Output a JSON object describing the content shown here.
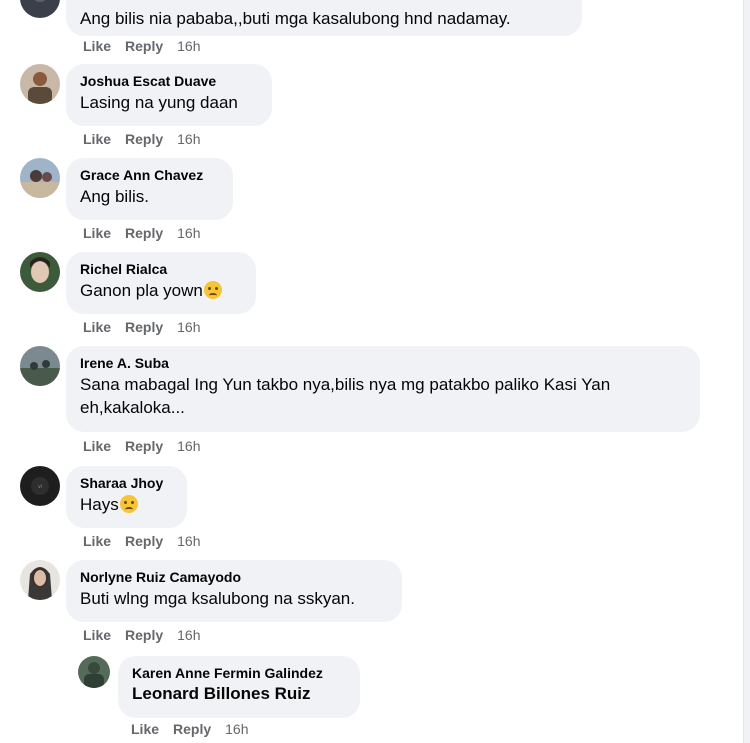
{
  "comments": [
    {
      "name": "",
      "text": "Ang bilis nia pababa,,buti mga kasalubong hnd nadamay.",
      "like": "Like",
      "reply": "Reply",
      "time": "16h"
    },
    {
      "name": "Joshua Escat Duave",
      "text": "Lasing na yung daan",
      "like": "Like",
      "reply": "Reply",
      "time": "16h"
    },
    {
      "name": "Grace Ann Chavez",
      "text": "Ang bilis.",
      "like": "Like",
      "reply": "Reply",
      "time": "16h"
    },
    {
      "name": "Richel Rialca",
      "text": "Ganon pla yown",
      "emoji": "thinking-face",
      "like": "Like",
      "reply": "Reply",
      "time": "16h"
    },
    {
      "name": "Irene A. Suba",
      "text_line1": "Sana mabagal Ing Yun takbo nya,bilis nya mg patakbo paliko Kasi Yan",
      "text_line2": "eh,kakaloka...",
      "like": "Like",
      "reply": "Reply",
      "time": "16h"
    },
    {
      "name": "Sharaa Jhoy",
      "text": "Hays",
      "emoji": "sad-face",
      "like": "Like",
      "reply": "Reply",
      "time": "16h"
    },
    {
      "name": "Norlyne Ruiz Camayodo",
      "text": "Buti wlng mga ksalubong na sskyan.",
      "like": "Like",
      "reply": "Reply",
      "time": "16h"
    }
  ],
  "reply": {
    "name": "Karen Anne Fermin Galindez",
    "tagged": "Leonard Billones Ruiz",
    "like": "Like",
    "reply": "Reply",
    "time": "16h"
  }
}
